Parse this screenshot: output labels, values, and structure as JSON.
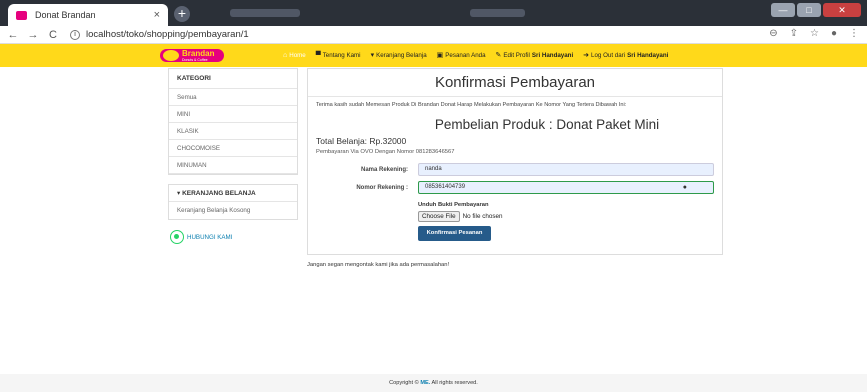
{
  "browser": {
    "tab_title": "Donat Brandan",
    "tab_close": "×",
    "new_tab": "+",
    "url": "localhost/toko/shopping/pembayaran/1",
    "window_buttons": [
      "—",
      "□",
      "✕"
    ],
    "dropdown": "⌄"
  },
  "brand": {
    "name": "Brandan",
    "sub": "Donuts & Coffee",
    "primary_color": "#e6007e",
    "nav_color": "#ffd91a"
  },
  "nav": {
    "items": [
      {
        "label": "Home",
        "icon": "home-icon",
        "glyph": "⌂",
        "active": true
      },
      {
        "label": "Tentang Kami",
        "icon": "building-icon",
        "glyph": "▀"
      },
      {
        "label": "Keranjang Belanja",
        "icon": "cart-icon",
        "glyph": "▾"
      },
      {
        "label": "Pesanan Anda",
        "icon": "inbox-icon",
        "glyph": "▣"
      },
      {
        "label": "Edit Profil",
        "bold": "Sri Handayani",
        "icon": "edit-icon",
        "glyph": "✎"
      },
      {
        "label": "Log Out dari",
        "bold": "Sri Handayani",
        "icon": "logout-icon",
        "glyph": "➜"
      }
    ]
  },
  "sidebar": {
    "kategori_title": "KATEGORI",
    "kategori": [
      "Semua",
      "MINI",
      "KLASIK",
      "CHOCOMOISE",
      "MINUMAN"
    ],
    "cart_title": "KERANJANG BELANJA",
    "cart_empty": "Keranjang Belanja Kosong",
    "contact": "HUBUNGI KAMI"
  },
  "main": {
    "title": "Konfirmasi Pembayaran",
    "thanks": "Terima kasih sudah Memesan Produk Di Brandan Donat Harap Melakukan Pembayaran Ke Nomor Yang Tertera Dibawah Ini:",
    "product_title": "Pembelian Produk : Donat Paket Mini",
    "total": "Total Belanja: Rp.32000",
    "via": "Pembayaran Via OVO Dengan Nomor 081283646567",
    "form": {
      "nama_label": "Nama Rekening:",
      "nama_value": "nanda",
      "nomor_label": "Nomor Rekening :",
      "nomor_value": "085361404739",
      "unduh_label": "Unduh Bukti Pembayaran",
      "file_button": "Choose File",
      "file_status": "No file chosen",
      "submit": "Konfirmasi Pesanan"
    }
  },
  "footnote": "Jangan segan mengontak kami jika ada permasalahan!",
  "copyright": {
    "prefix": "Copyright ©",
    "brand": "ME.",
    "suffix": "All rights reserved."
  }
}
